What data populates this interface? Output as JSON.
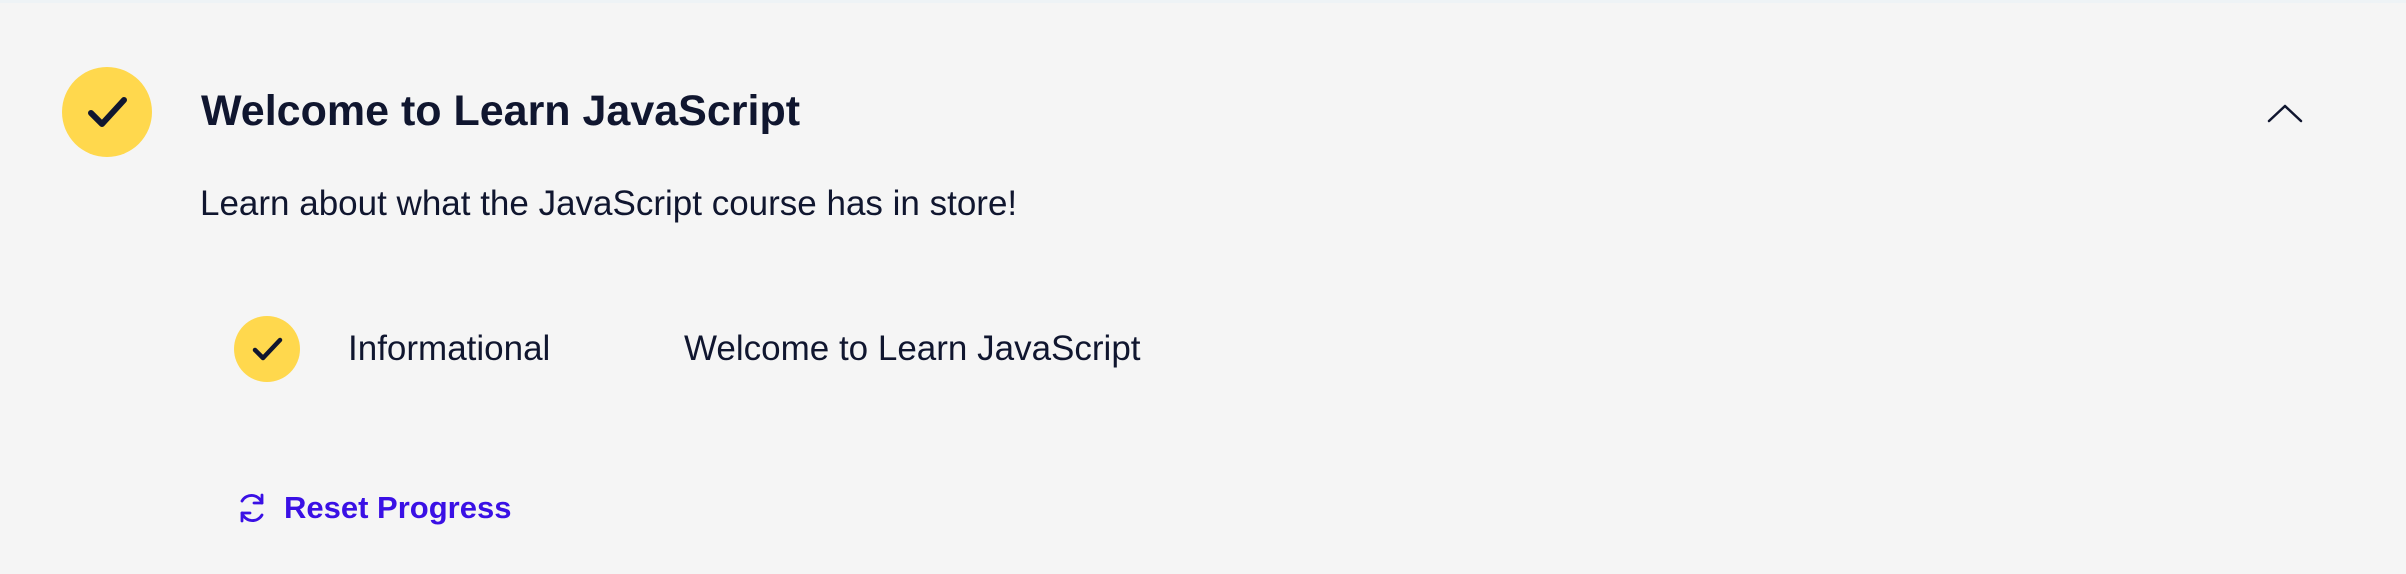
{
  "module": {
    "title": "Welcome to Learn JavaScript",
    "description": "Learn about what the JavaScript course has in store!",
    "status_icon": "check-icon",
    "toggle_icon": "chevron-up-icon",
    "lessons": [
      {
        "type": "Informational",
        "name": "Welcome to Learn JavaScript",
        "status_icon": "check-icon"
      }
    ],
    "reset": {
      "label": "Reset Progress",
      "icon": "refresh-icon"
    }
  },
  "colors": {
    "complete": "#ffd84d",
    "text": "#10162f",
    "link": "#3a10e5",
    "background": "#f5f5f5"
  }
}
